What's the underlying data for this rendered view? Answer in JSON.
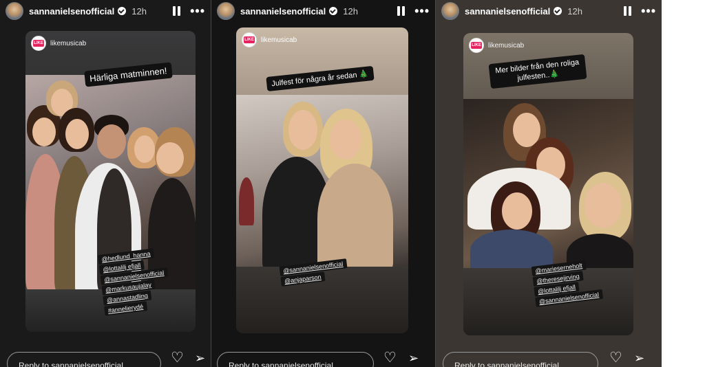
{
  "stories": [
    {
      "username": "sannanielsenofficial",
      "time": "12h",
      "reposted_from": "likemusicab",
      "logo_text": "LIKE",
      "caption": "Härliga matminnen!",
      "tags": [
        "@hedlund_hanna",
        "@lottalilj efjall",
        "@sannanielsenofficial",
        "@markusaujalay",
        "@annastadling",
        "#annelierydé"
      ],
      "reply_placeholder": "Reply to sannanielsenofficial..."
    },
    {
      "username": "sannanielsenofficial",
      "time": "12h",
      "reposted_from": "likemusicab",
      "logo_text": "LIKE",
      "caption": "Julfest för några år sedan 🎄",
      "tags": [
        "@sannanielsenofficial",
        "@anjaparson"
      ],
      "reply_placeholder": "Reply to sannanielsenofficial..."
    },
    {
      "username": "sannanielsenofficial",
      "time": "12h",
      "reposted_from": "likemusicab",
      "logo_text": "LIKE",
      "caption": "Mer bilder från den roliga julfesten..🎄",
      "tags": [
        "@marieserneholt",
        "@theresejirving",
        "@lottalilj efjall",
        "@sannanielsenofficial"
      ],
      "reply_placeholder": "Reply to sannanielsenofficial..."
    }
  ],
  "icons": {
    "pause": "pause-icon",
    "more": "more-icon",
    "like": "heart-icon",
    "share": "send-icon"
  },
  "colors": {
    "logo_brand": "#e5245e",
    "panel_dark": "#1a1a1a"
  }
}
